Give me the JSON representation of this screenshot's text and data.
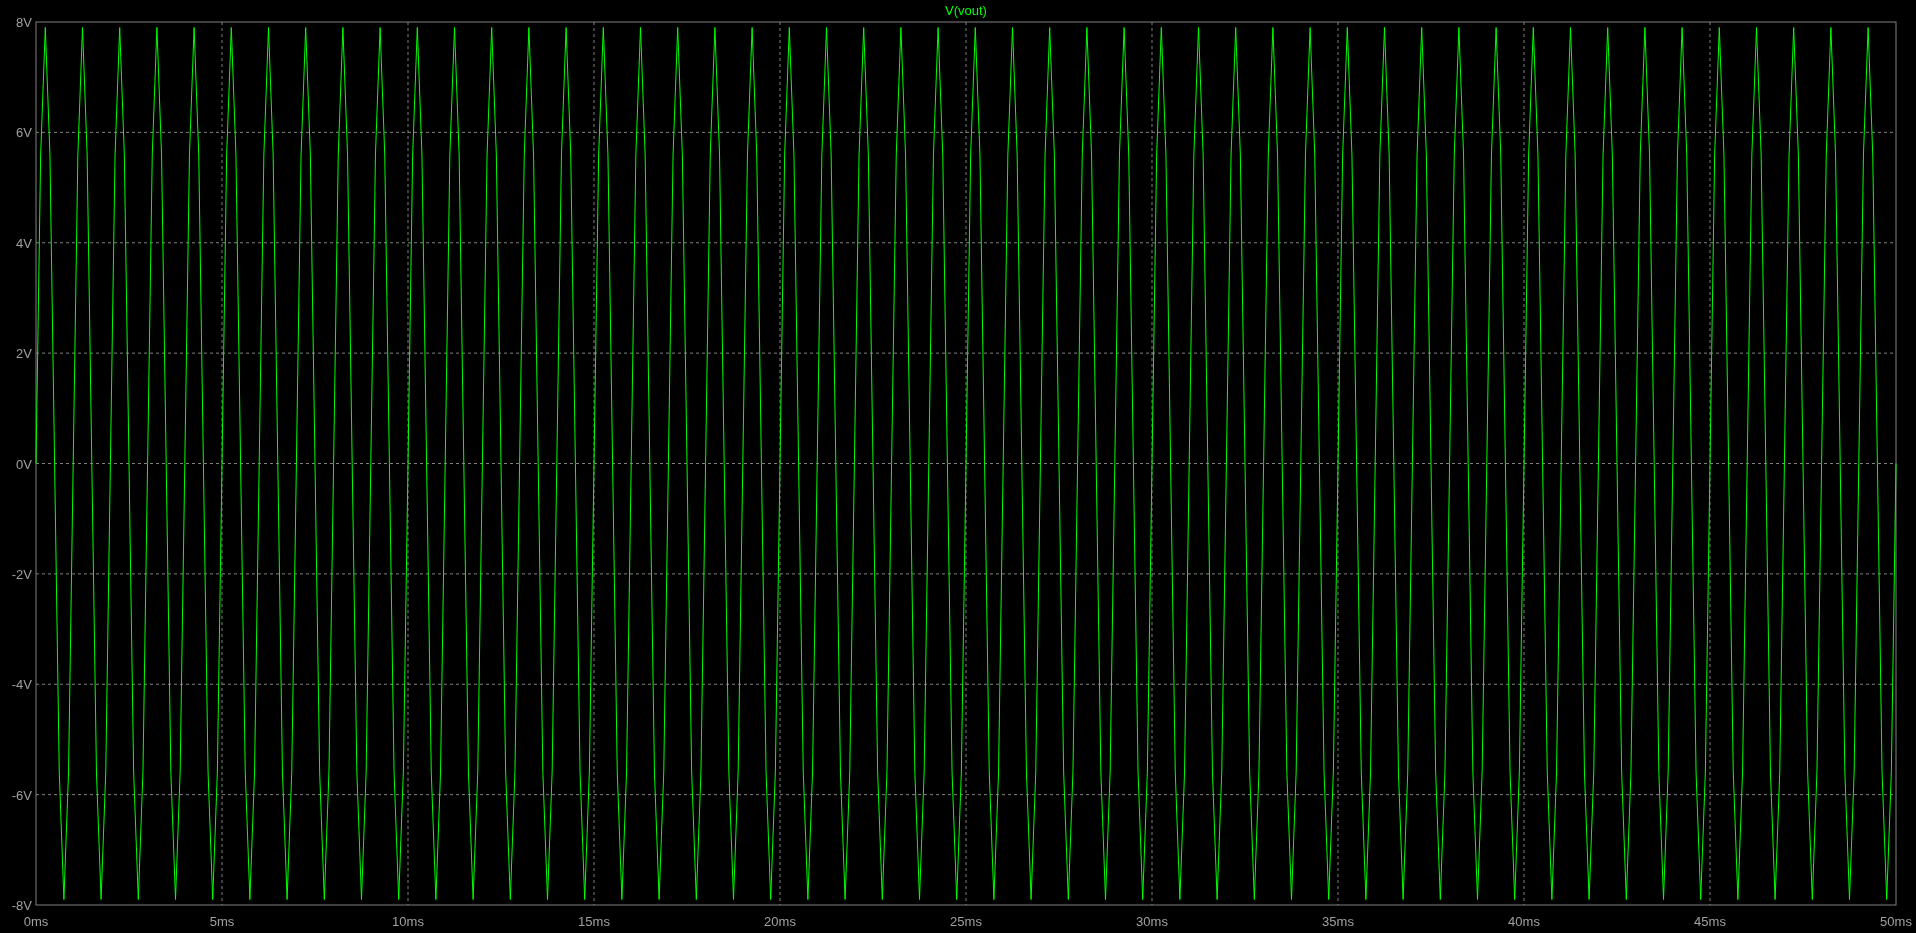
{
  "chart_data": {
    "type": "line",
    "title": "V(vout)",
    "grid": true,
    "xlim": [
      0,
      50
    ],
    "ylim": [
      -8,
      8
    ],
    "xticks": [
      {
        "value": 0,
        "label": "0ms"
      },
      {
        "value": 5,
        "label": "5ms"
      },
      {
        "value": 10,
        "label": "10ms"
      },
      {
        "value": 15,
        "label": "15ms"
      },
      {
        "value": 20,
        "label": "20ms"
      },
      {
        "value": 25,
        "label": "25ms"
      },
      {
        "value": 30,
        "label": "30ms"
      },
      {
        "value": 35,
        "label": "35ms"
      },
      {
        "value": 40,
        "label": "40ms"
      },
      {
        "value": 45,
        "label": "45ms"
      },
      {
        "value": 50,
        "label": "50ms"
      }
    ],
    "yticks": [
      {
        "value": 8,
        "label": "8V"
      },
      {
        "value": 6,
        "label": "6V"
      },
      {
        "value": 4,
        "label": "4V"
      },
      {
        "value": 2,
        "label": "2V"
      },
      {
        "value": 0,
        "label": "0V"
      },
      {
        "value": -2,
        "label": "-2V"
      },
      {
        "value": -4,
        "label": "-4V"
      },
      {
        "value": -6,
        "label": "-6V"
      },
      {
        "value": -8,
        "label": "-8V"
      }
    ],
    "x": [
      0,
      0.125,
      0.25,
      0.375,
      0.5,
      0.625,
      0.75,
      0.875,
      1,
      1.125,
      1.25,
      1.375,
      1.5,
      1.625,
      1.75,
      1.875,
      2,
      2.125,
      2.25,
      2.375,
      2.5,
      2.625,
      2.75,
      2.875,
      3,
      3.125,
      3.25,
      3.375,
      3.5,
      3.625,
      3.75,
      3.875,
      4,
      4.125,
      4.25,
      4.375,
      4.5,
      4.625,
      4.75,
      4.875,
      5,
      5.125,
      5.25,
      5.375,
      5.5,
      5.625,
      5.75,
      5.875,
      6,
      6.125,
      6.25,
      6.375,
      6.5,
      6.625,
      6.75,
      6.875,
      7,
      7.125,
      7.25,
      7.375,
      7.5,
      7.625,
      7.75,
      7.875,
      8,
      8.125,
      8.25,
      8.375,
      8.5,
      8.625,
      8.75,
      8.875,
      9,
      9.125,
      9.25,
      9.375,
      9.5,
      9.625,
      9.75,
      9.875,
      10,
      10.125,
      10.25,
      10.375,
      10.5,
      10.625,
      10.75,
      10.875,
      11,
      11.125,
      11.25,
      11.375,
      11.5,
      11.625,
      11.75,
      11.875,
      12,
      12.125,
      12.25,
      12.375,
      12.5,
      12.625,
      12.75,
      12.875,
      13,
      13.125,
      13.25,
      13.375,
      13.5,
      13.625,
      13.75,
      13.875,
      14,
      14.125,
      14.25,
      14.375,
      14.5,
      14.625,
      14.75,
      14.875,
      15,
      15.125,
      15.25,
      15.375,
      15.5,
      15.625,
      15.75,
      15.875,
      16,
      16.125,
      16.25,
      16.375,
      16.5,
      16.625,
      16.75,
      16.875,
      17,
      17.125,
      17.25,
      17.375,
      17.5,
      17.625,
      17.75,
      17.875,
      18,
      18.125,
      18.25,
      18.375,
      18.5,
      18.625,
      18.75,
      18.875,
      19,
      19.125,
      19.25,
      19.375,
      19.5,
      19.625,
      19.75,
      19.875,
      20,
      20.125,
      20.25,
      20.375,
      20.5,
      20.625,
      20.75,
      20.875,
      21,
      21.125,
      21.25,
      21.375,
      21.5,
      21.625,
      21.75,
      21.875,
      22,
      22.125,
      22.25,
      22.375,
      22.5,
      22.625,
      22.75,
      22.875,
      23,
      23.125,
      23.25,
      23.375,
      23.5,
      23.625,
      23.75,
      23.875,
      24,
      24.125,
      24.25,
      24.375,
      24.5,
      24.625,
      24.75,
      24.875,
      25,
      25.125,
      25.25,
      25.375,
      25.5,
      25.625,
      25.75,
      25.875,
      26,
      26.125,
      26.25,
      26.375,
      26.5,
      26.625,
      26.75,
      26.875,
      27,
      27.125,
      27.25,
      27.375,
      27.5,
      27.625,
      27.75,
      27.875,
      28,
      28.125,
      28.25,
      28.375,
      28.5,
      28.625,
      28.75,
      28.875,
      29,
      29.125,
      29.25,
      29.375,
      29.5,
      29.625,
      29.75,
      29.875,
      30,
      30.125,
      30.25,
      30.375,
      30.5,
      30.625,
      30.75,
      30.875,
      31,
      31.125,
      31.25,
      31.375,
      31.5,
      31.625,
      31.75,
      31.875,
      32,
      32.125,
      32.25,
      32.375,
      32.5,
      32.625,
      32.75,
      32.875,
      33,
      33.125,
      33.25,
      33.375,
      33.5,
      33.625,
      33.75,
      33.875,
      34,
      34.125,
      34.25,
      34.375,
      34.5,
      34.625,
      34.75,
      34.875,
      35,
      35.125,
      35.25,
      35.375,
      35.5,
      35.625,
      35.75,
      35.875,
      36,
      36.125,
      36.25,
      36.375,
      36.5,
      36.625,
      36.75,
      36.875,
      37,
      37.125,
      37.25,
      37.375,
      37.5,
      37.625,
      37.75,
      37.875,
      38,
      38.125,
      38.25,
      38.375,
      38.5,
      38.625,
      38.75,
      38.875,
      39,
      39.125,
      39.25,
      39.375,
      39.5,
      39.625,
      39.75,
      39.875,
      40,
      40.125,
      40.25,
      40.375,
      40.5,
      40.625,
      40.75,
      40.875,
      41,
      41.125,
      41.25,
      41.375,
      41.5,
      41.625,
      41.75,
      41.875,
      42,
      42.125,
      42.25,
      42.375,
      42.5,
      42.625,
      42.75,
      42.875,
      43,
      43.125,
      43.25,
      43.375,
      43.5,
      43.625,
      43.75,
      43.875,
      44,
      44.125,
      44.25,
      44.375,
      44.5,
      44.625,
      44.75,
      44.875,
      45,
      45.125,
      45.25,
      45.375,
      45.5,
      45.625,
      45.75,
      45.875,
      46,
      46.125,
      46.25,
      46.375,
      46.5,
      46.625,
      46.75,
      46.875,
      47,
      47.125,
      47.25,
      47.375,
      47.5,
      47.625,
      47.75,
      47.875,
      48,
      48.125,
      48.25,
      48.375,
      48.5,
      48.625,
      48.75,
      48.875,
      49,
      49.125,
      49.25,
      49.375,
      49.5,
      49.625,
      49.75,
      49.875,
      50
    ],
    "series": [
      {
        "color": "#00ff00",
        "values": [
          0,
          5.59,
          7.9,
          5.59,
          0,
          -5.59,
          -7.9,
          -5.59,
          0,
          5.59,
          7.9,
          5.59,
          0,
          -5.59,
          -7.9,
          -5.59,
          0,
          5.59,
          7.9,
          5.59,
          0,
          -5.59,
          -7.9,
          -5.59,
          0,
          5.59,
          7.9,
          5.59,
          0,
          -5.59,
          -7.9,
          -5.59,
          0,
          5.59,
          7.9,
          5.59,
          0,
          -5.59,
          -7.9,
          -5.59,
          0,
          5.59,
          7.9,
          5.59,
          0,
          -5.59,
          -7.9,
          -5.59,
          0,
          5.59,
          7.9,
          5.59,
          0,
          -5.59,
          -7.9,
          -5.59,
          0,
          5.59,
          7.9,
          5.59,
          0,
          -5.59,
          -7.9,
          -5.59,
          0,
          5.59,
          7.9,
          5.59,
          0,
          -5.59,
          -7.9,
          -5.59,
          0,
          5.59,
          7.9,
          5.59,
          0,
          -5.59,
          -7.9,
          -5.59,
          0,
          5.59,
          7.9,
          5.59,
          0,
          -5.59,
          -7.9,
          -5.59,
          0,
          5.59,
          7.9,
          5.59,
          0,
          -5.59,
          -7.9,
          -5.59,
          0,
          5.59,
          7.9,
          5.59,
          0,
          -5.59,
          -7.9,
          -5.59,
          0,
          5.59,
          7.9,
          5.59,
          0,
          -5.59,
          -7.9,
          -5.59,
          0,
          5.59,
          7.9,
          5.59,
          0,
          -5.59,
          -7.9,
          -5.59,
          0,
          5.59,
          7.9,
          5.59,
          0,
          -5.59,
          -7.9,
          -5.59,
          0,
          5.59,
          7.9,
          5.59,
          0,
          -5.59,
          -7.9,
          -5.59,
          0,
          5.59,
          7.9,
          5.59,
          0,
          -5.59,
          -7.9,
          -5.59,
          0,
          5.59,
          7.9,
          5.59,
          0,
          -5.59,
          -7.9,
          -5.59,
          0,
          5.59,
          7.9,
          5.59,
          0,
          -5.59,
          -7.9,
          -5.59,
          0,
          5.59,
          7.9,
          5.59,
          0,
          -5.59,
          -7.9,
          -5.59,
          0,
          5.59,
          7.9,
          5.59,
          0,
          -5.59,
          -7.9,
          -5.59,
          0,
          5.59,
          7.9,
          5.59,
          0,
          -5.59,
          -7.9,
          -5.59,
          0,
          5.59,
          7.9,
          5.59,
          0,
          -5.59,
          -7.9,
          -5.59,
          0,
          5.59,
          7.9,
          5.59,
          0,
          -5.59,
          -7.9,
          -5.59,
          0,
          5.59,
          7.9,
          5.59,
          0,
          -5.59,
          -7.9,
          -5.59,
          0,
          5.59,
          7.9,
          5.59,
          0,
          -5.59,
          -7.9,
          -5.59,
          0,
          5.59,
          7.9,
          5.59,
          0,
          -5.59,
          -7.9,
          -5.59,
          0,
          5.59,
          7.9,
          5.59,
          0,
          -5.59,
          -7.9,
          -5.59,
          0,
          5.59,
          7.9,
          5.59,
          0,
          -5.59,
          -7.9,
          -5.59,
          0,
          5.59,
          7.9,
          5.59,
          0,
          -5.59,
          -7.9,
          -5.59,
          0,
          5.59,
          7.9,
          5.59,
          0,
          -5.59,
          -7.9,
          -5.59,
          0,
          5.59,
          7.9,
          5.59,
          0,
          -5.59,
          -7.9,
          -5.59,
          0,
          5.59,
          7.9,
          5.59,
          0,
          -5.59,
          -7.9,
          -5.59,
          0,
          5.59,
          7.9,
          5.59,
          0,
          -5.59,
          -7.9,
          -5.59,
          0,
          5.59,
          7.9,
          5.59,
          0,
          -5.59,
          -7.9,
          -5.59,
          0,
          5.59,
          7.9,
          5.59,
          0,
          -5.59,
          -7.9,
          -5.59,
          0,
          5.59,
          7.9,
          5.59,
          0,
          -5.59,
          -7.9,
          -5.59,
          0,
          5.59,
          7.9,
          5.59,
          0,
          -5.59,
          -7.9,
          -5.59,
          0,
          5.59,
          7.9,
          5.59,
          0,
          -5.59,
          -7.9,
          -5.59,
          0,
          5.59,
          7.9,
          5.59,
          0,
          -5.59,
          -7.9,
          -5.59,
          0,
          5.59,
          7.9,
          5.59,
          0,
          -5.59,
          -7.9,
          -5.59,
          0,
          5.59,
          7.9,
          5.59,
          0,
          -5.59,
          -7.9,
          -5.59,
          0,
          5.59,
          7.9,
          5.59,
          0,
          -5.59,
          -7.9,
          -5.59,
          0,
          5.59,
          7.9,
          5.59,
          0,
          -5.59,
          -7.9,
          -5.59,
          0,
          5.59,
          7.9,
          5.59,
          0,
          -5.59,
          -7.9,
          -5.59,
          0,
          5.59,
          7.9,
          5.59,
          0,
          -5.59,
          -7.9,
          -5.59,
          0,
          5.59,
          7.9,
          5.59,
          0,
          -5.59,
          -7.9,
          -5.59,
          0,
          5.59,
          7.9,
          5.59,
          0,
          -5.59,
          -7.9,
          -5.59,
          0,
          5.59,
          7.9,
          5.59,
          0,
          -5.59,
          -7.9,
          -5.59,
          0
        ]
      }
    ]
  }
}
